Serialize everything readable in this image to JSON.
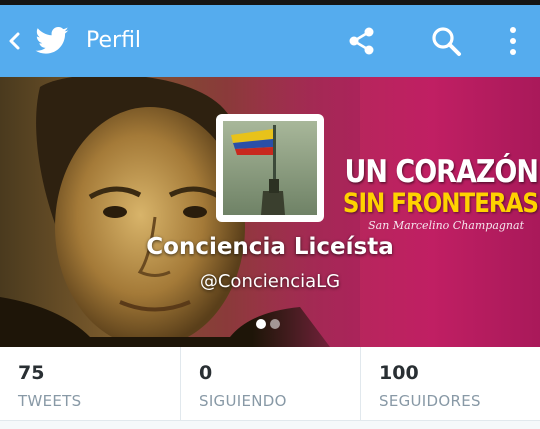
{
  "action_bar": {
    "title": "Perfil",
    "icons": [
      "back-chevron-icon",
      "twitter-bird-icon",
      "share-icon",
      "search-icon",
      "overflow-menu-icon"
    ],
    "color": "#55acee"
  },
  "banner": {
    "slogan_line1": "UN CORAZÓN",
    "slogan_line2": "SIN FRONTERAS",
    "signature": "San Marcelino Champagnat",
    "accent_color": "#c01f63",
    "slogan_color": "#ffd200"
  },
  "profile": {
    "display_name": "Conciencia Liceísta",
    "handle": "@ConcienciaLG",
    "pager": {
      "pages": 2,
      "active": 1
    }
  },
  "stats": [
    {
      "value": "75",
      "label": "TWEETS"
    },
    {
      "value": "0",
      "label": "SIGUIENDO"
    },
    {
      "value": "100",
      "label": "SEGUIDORES"
    }
  ]
}
